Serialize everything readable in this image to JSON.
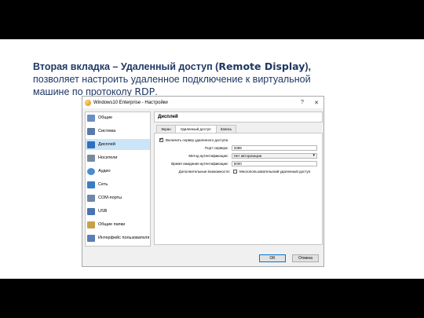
{
  "slide": {
    "headline_bold": "Вторая вкладка – Удаленный доступ (",
    "headline_mono": "Remote Display",
    "headline_bold_end": "),",
    "headline_rest": " позволяет настроить удаленное подключение к виртуальной машине по протоколу ",
    "headline_proto": "RDP",
    "headline_period": "."
  },
  "window": {
    "title": "Windows10 Enterprise - Настройки",
    "help": "?",
    "close": "✕"
  },
  "sidebar": {
    "items": [
      {
        "label": "Общие",
        "icon": "general-icon",
        "color": "#6a8fc4"
      },
      {
        "label": "Система",
        "icon": "system-icon",
        "color": "#5a7aa6"
      },
      {
        "label": "Дисплей",
        "icon": "display-icon",
        "color": "#2f6fbf"
      },
      {
        "label": "Носители",
        "icon": "storage-icon",
        "color": "#7a8a9e"
      },
      {
        "label": "Аудио",
        "icon": "audio-icon",
        "color": "#4d8bd0"
      },
      {
        "label": "Сеть",
        "icon": "network-icon",
        "color": "#3b7dc4"
      },
      {
        "label": "COM-порты",
        "icon": "serial-icon",
        "color": "#6e88a8"
      },
      {
        "label": "USB",
        "icon": "usb-icon",
        "color": "#4a74b0"
      },
      {
        "label": "Общие папки",
        "icon": "shared-folders-icon",
        "color": "#c7a14a"
      },
      {
        "label": "Интерфейс пользователя",
        "icon": "ui-icon",
        "color": "#5b7fb3"
      }
    ],
    "selected_index": 2
  },
  "content": {
    "section_title": "Дисплей",
    "tabs": [
      "Экран",
      "Удаленный доступ",
      "Запись"
    ],
    "active_tab": 1,
    "enable_server": "Включить сервер удаленного доступа",
    "port_label": "Порт сервера:",
    "port_value": "3389",
    "auth_label": "Метод аутентификации:",
    "auth_value": "Нет авторизации",
    "timeout_label": "Время ожидания аутентификации:",
    "timeout_value": "5000",
    "extra_label": "Дополнительные возможности:",
    "multi_conn": "Многопользовательский удаленный доступ"
  },
  "buttons": {
    "ok": "OK",
    "cancel": "Отмена"
  }
}
